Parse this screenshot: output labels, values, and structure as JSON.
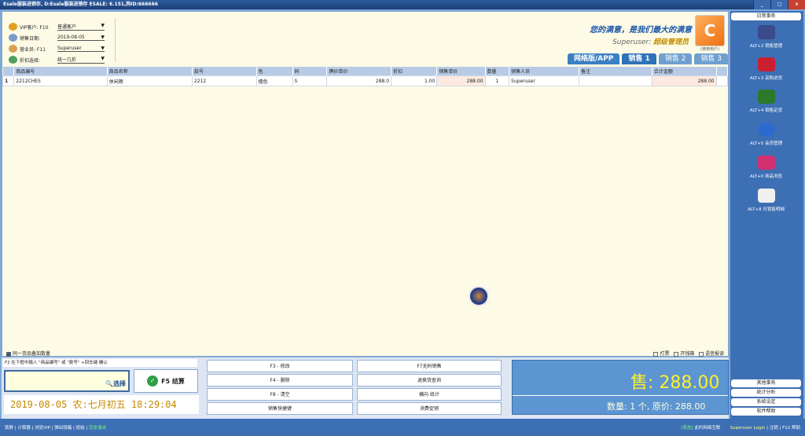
{
  "window": {
    "title": "Esale服装进销存, D:Esale服装进销存  ESALE: 6.151,狗ID:666666",
    "btn_min": "_",
    "btn_max": "□",
    "btn_close": "×"
  },
  "form": {
    "vip_label": "VIP客户: F10",
    "vip_value": "普通客户",
    "date_label": "销售日期:",
    "date_value": "2019-08-05",
    "clerk_label": "营业员:  F11",
    "clerk_value": "Superuser",
    "discount_label": "折扣选择:",
    "discount_value": "统一几折",
    "dropdown_arrow": "▼"
  },
  "slogan": "您的满意，是我们最大的满意",
  "user": {
    "name": "Superuser:",
    "role": "超级管理员"
  },
  "logo_label": "(使用用户)",
  "tabs": [
    "网络版/APP",
    "销售 1",
    "销售 2",
    "销售 3"
  ],
  "table": {
    "headers": [
      "",
      "商品编号",
      "商品名称",
      "款号",
      "色",
      "码",
      "牌价单价",
      "折扣",
      "销售单价",
      "数量",
      "销售人员",
      "备注",
      "合计金额"
    ],
    "rows": [
      [
        "1",
        "2212CHES",
        "休闲裤",
        "2212",
        "檀色",
        "S",
        "288.0",
        "1.00",
        "288.00",
        "1",
        "Superuser",
        "",
        "288.00"
      ]
    ]
  },
  "options": {
    "same_item": "同一货品叠加数量",
    "print": "打票",
    "drawer": "开钱箱",
    "voice": "语音报读"
  },
  "hint": "F2  在下框中输入 \"商品编号\" 或 \"款号\" +回车键 确认",
  "select_label": "选择",
  "settle_label": "F5  结算",
  "clock": "2019-08-05   农:七月初五   18:29:04",
  "fkeys": [
    "F3 - 修改",
    "F4 - 删除",
    "F8 - 清空",
    "销售快捷键",
    "F7无码销售",
    "退换货查询",
    "横向 统计",
    "消费促销"
  ],
  "total": {
    "amount": "售:  288.00",
    "count": "数量: 1 个, 原价: 288.00"
  },
  "status": {
    "left": "锁屏 | 计算器 | 浏览VIP | 弹出钱箱 | 班结 |",
    "exit": "完全退出",
    "state": "[状态]",
    "net": "此时网络互联",
    "login": "Superuser Login",
    "logout": "| 注销 |",
    "help": "F12 帮助"
  },
  "sidebar": {
    "top": "日常事务",
    "items": [
      "ALT+2 销售管理",
      "ALT+3 采购进货",
      "ALT+4 销售定货",
      "ALT+5 会员管理",
      "ALT+0 商品浏览",
      "ALT+8 日销售明细"
    ],
    "bottom": [
      "其他事务",
      "统计分析",
      "系统设定",
      "软件帮助"
    ]
  }
}
